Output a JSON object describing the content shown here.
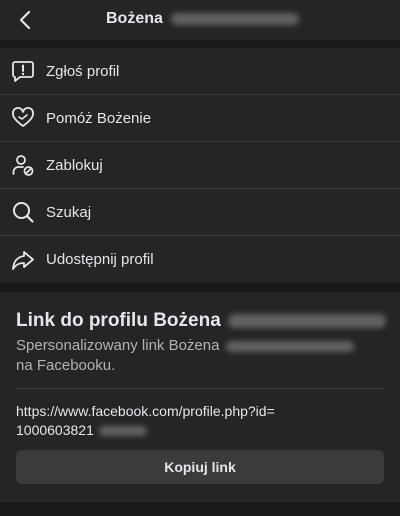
{
  "header": {
    "title": "Bożena"
  },
  "menu": {
    "items": [
      {
        "label": "Zgłoś profil",
        "icon": "report-icon"
      },
      {
        "label": "Pomóż Bożenie",
        "icon": "heart-icon"
      },
      {
        "label": "Zablokuj",
        "icon": "block-user-icon"
      },
      {
        "label": "Szukaj",
        "icon": "search-icon"
      },
      {
        "label": "Udostępnij profil",
        "icon": "share-icon"
      }
    ]
  },
  "link_section": {
    "title": "Link do profilu Bożena",
    "description_prefix": "Spersonalizowany link Bożena",
    "description_suffix": "na Facebooku.",
    "url_prefix": "https://www.facebook.com/profile.php?id=",
    "url_visible": "1000603821",
    "copy_label": "Kopiuj link"
  },
  "colors": {
    "background": "#18191a",
    "surface": "#242526",
    "divider": "#3a3b3c",
    "text_primary": "#e4e6eb",
    "text_secondary": "#b0b3b8",
    "button": "#3a3b3c"
  }
}
